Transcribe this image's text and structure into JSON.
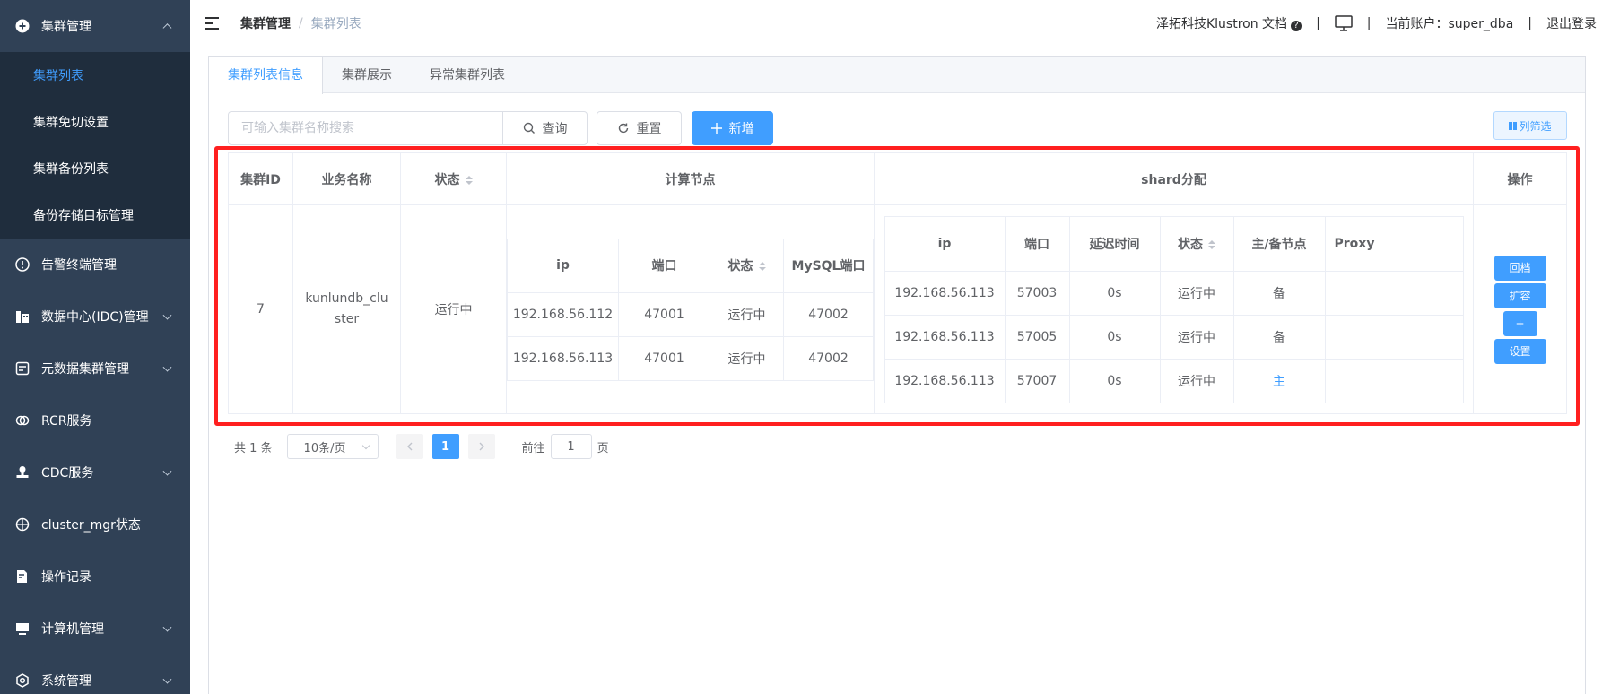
{
  "sidebar": {
    "groups": [
      {
        "label": "集群管理",
        "icon": "plus-circle-icon",
        "expanded": true,
        "items": [
          "集群列表",
          "集群免切设置",
          "集群备份列表",
          "备份存储目标管理"
        ],
        "active_item": "集群列表"
      },
      {
        "label": "告警终端管理",
        "icon": "alert-circle-icon",
        "expanded": false,
        "has_children": false
      },
      {
        "label": "数据中心(IDC)管理",
        "icon": "building-icon",
        "expanded": false,
        "has_children": true
      },
      {
        "label": "元数据集群管理",
        "icon": "database-icon",
        "expanded": false,
        "has_children": true
      },
      {
        "label": "RCR服务",
        "icon": "link-icon",
        "expanded": false,
        "has_children": false
      },
      {
        "label": "CDC服务",
        "icon": "stamp-icon",
        "expanded": false,
        "has_children": true
      },
      {
        "label": "cluster_mgr状态",
        "icon": "crosshair-icon",
        "expanded": false,
        "has_children": false
      },
      {
        "label": "操作记录",
        "icon": "edit-doc-icon",
        "expanded": false,
        "has_children": false
      },
      {
        "label": "计算机管理",
        "icon": "monitor-icon",
        "expanded": false,
        "has_children": true
      },
      {
        "label": "系统管理",
        "icon": "settings-icon",
        "expanded": false,
        "has_children": true
      }
    ]
  },
  "header": {
    "breadcrumb": {
      "home": "集群管理",
      "separator": "/",
      "current": "集群列表"
    },
    "docs_label": "泽拓科技Klustron 文档",
    "account_label": "当前账户：super_dba",
    "logout_label": "退出登录",
    "separator": "|"
  },
  "tabs": [
    {
      "label": "集群列表信息",
      "active": true
    },
    {
      "label": "集群展示",
      "active": false
    },
    {
      "label": "异常集群列表",
      "active": false
    }
  ],
  "toolbar": {
    "search_placeholder": "可输入集群名称搜索",
    "query_label": "查询",
    "reset_label": "重置",
    "add_label": "新增",
    "column_filter_label": "列筛选"
  },
  "table": {
    "headers": {
      "id": "集群ID",
      "name": "业务名称",
      "status": "状态",
      "compute": "计算节点",
      "shard": "shard分配",
      "ops": "操作"
    },
    "compute_headers": [
      "ip",
      "端口",
      "状态",
      "MySQL端口"
    ],
    "shard_headers": [
      "ip",
      "端口",
      "延迟时间",
      "状态",
      "主/备节点",
      "Proxy"
    ],
    "rows": [
      {
        "id": "7",
        "name": "kunlundb_cluster",
        "status": "运行中",
        "compute_nodes": [
          {
            "ip": "192.168.56.112",
            "port": "47001",
            "status": "运行中",
            "mysql_port": "47002"
          },
          {
            "ip": "192.168.56.113",
            "port": "47001",
            "status": "运行中",
            "mysql_port": "47002"
          }
        ],
        "shards": [
          {
            "ip": "192.168.56.113",
            "port": "57003",
            "delay": "0s",
            "status": "运行中",
            "role": "备",
            "proxy": ""
          },
          {
            "ip": "192.168.56.113",
            "port": "57005",
            "delay": "0s",
            "status": "运行中",
            "role": "备",
            "proxy": ""
          },
          {
            "ip": "192.168.56.113",
            "port": "57007",
            "delay": "0s",
            "status": "运行中",
            "role": "主",
            "proxy": ""
          }
        ],
        "ops": [
          "回档",
          "扩容",
          "+",
          "设置"
        ]
      }
    ]
  },
  "pagination": {
    "total_label": "共 1 条",
    "page_size_label": "10条/页",
    "current_page": "1",
    "goto_label": "前往",
    "goto_value": "1",
    "page_suffix": "页"
  },
  "colors": {
    "sidebar_bg": "#304156",
    "submenu_bg": "#1f2d3d",
    "primary": "#409eff",
    "success": "#13ce66",
    "highlight_box": "#ff2020"
  }
}
